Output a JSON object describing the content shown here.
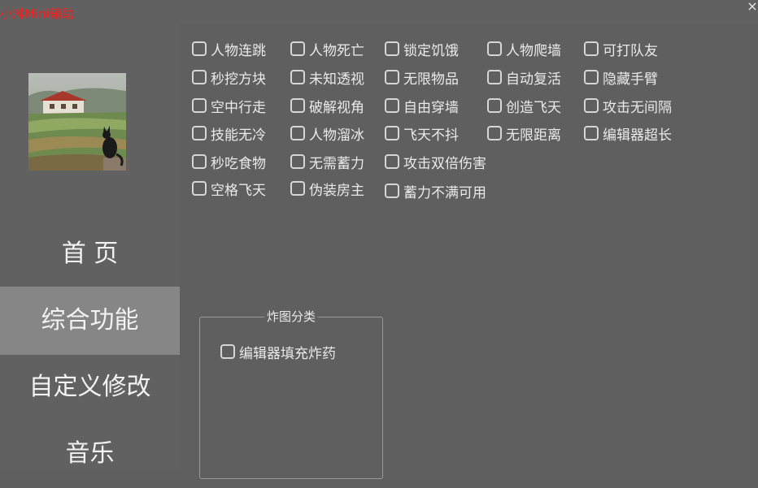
{
  "window": {
    "title": "小淋Mini辅助",
    "close_glyph": "×"
  },
  "sidebar": {
    "items": [
      {
        "label": "首 页"
      },
      {
        "label": "综合功能",
        "active": true
      },
      {
        "label": "自定义修改"
      },
      {
        "label": "音乐"
      }
    ]
  },
  "features": [
    "人物连跳",
    "人物死亡",
    "锁定饥饿",
    "人物爬墙",
    "可打队友",
    "秒挖方块",
    "未知透视",
    "无限物品",
    "自动复活",
    "隐藏手臂",
    "空中行走",
    "破解视角",
    "自由穿墙",
    "创造飞天",
    "攻击无间隔",
    "技能无冷",
    "人物溜冰",
    "飞天不抖",
    "无限距离",
    "编辑器超长",
    "秒吃食物",
    "无需蓄力",
    "攻击双倍伤害",
    "空格飞天",
    "伪装房主",
    "蓄力不满可用"
  ],
  "bomb_group": {
    "title": "炸图分类",
    "items": [
      "编辑器填充炸药"
    ]
  },
  "colors": {
    "background": "#5f5f5f",
    "sidebar": "#616161",
    "active_nav": "#868686",
    "title_text": "#ff1a1a"
  }
}
